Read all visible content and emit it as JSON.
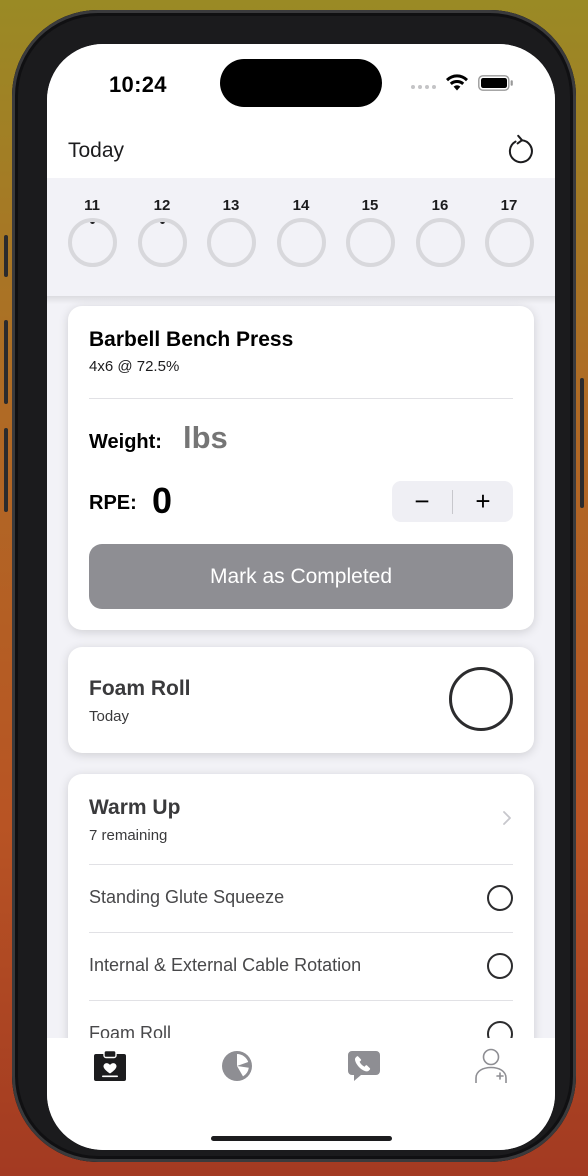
{
  "status": {
    "time": "10:24"
  },
  "nav": {
    "title": "Today"
  },
  "days": [
    {
      "num": "11",
      "has_dot": true
    },
    {
      "num": "12",
      "has_dot": true
    },
    {
      "num": "13",
      "has_dot": false
    },
    {
      "num": "14",
      "has_dot": false
    },
    {
      "num": "15",
      "has_dot": false
    },
    {
      "num": "16",
      "has_dot": false
    },
    {
      "num": "17",
      "has_dot": false
    }
  ],
  "exercise": {
    "title": "Barbell Bench Press",
    "prescription": "4x6 @ 72.5%",
    "weight_label": "Weight:",
    "weight_placeholder": "lbs",
    "rpe_label": "RPE:",
    "rpe_value": "0",
    "decrement": "−",
    "increment": "+",
    "complete_label": "Mark as Completed"
  },
  "foam_roll": {
    "title": "Foam Roll",
    "subtitle": "Today"
  },
  "warm_up": {
    "title": "Warm Up",
    "remaining": "7 remaining",
    "items": [
      {
        "label": "Standing Glute Squeeze"
      },
      {
        "label": "Internal & External Cable Rotation"
      },
      {
        "label": "Foam Roll"
      }
    ]
  },
  "tabs": [
    {
      "icon": "clipboard-heart-icon",
      "active": true
    },
    {
      "icon": "pie-chart-icon",
      "active": false
    },
    {
      "icon": "phone-bubble-icon",
      "active": false
    },
    {
      "icon": "person-add-icon",
      "active": false
    }
  ],
  "colors": {
    "accent": "#1c1c1e",
    "disabled_button": "#8e8e93",
    "ring": "#d8d8dc",
    "inactive_icon": "#8e8e93"
  }
}
